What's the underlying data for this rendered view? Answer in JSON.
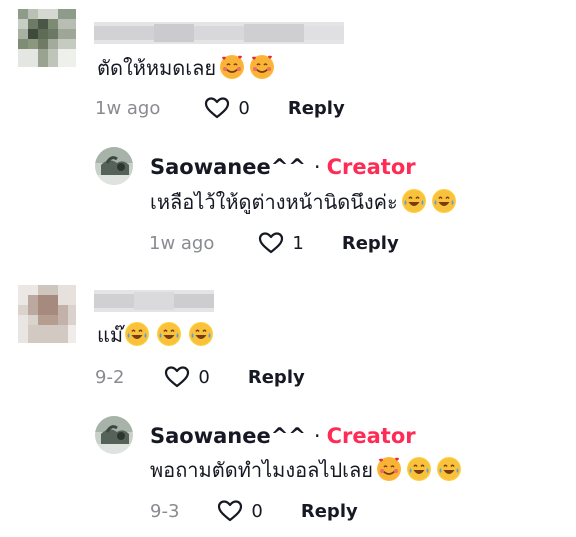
{
  "comments": [
    {
      "text": "ตัดให้หมดเลย",
      "emojis": [
        "smiling-face-with-hearts-icon",
        "smiling-face-with-hearts-icon"
      ],
      "time": "1w ago",
      "likes": "0",
      "reply_label": "Reply",
      "reply": {
        "username": "Saowanee^^",
        "separator": "·",
        "badge": "Creator",
        "text": "เหลือไว้ให้ดูต่างหน้านิดนึงค่ะ",
        "emojis": [
          "tears-of-joy-icon",
          "tears-of-joy-icon"
        ],
        "time": "1w ago",
        "likes": "1",
        "reply_label": "Reply"
      }
    },
    {
      "text": "แม๊",
      "emojis": [
        "tears-of-joy-icon",
        "tears-of-joy-icon",
        "tears-of-joy-icon"
      ],
      "time": "9-2",
      "likes": "0",
      "reply_label": "Reply",
      "reply": {
        "username": "Saowanee^^",
        "separator": "·",
        "badge": "Creator",
        "text": "พอถามตัดทำไมงอลไปเลย",
        "emojis": [
          "smiling-face-with-hearts-icon",
          "tears-of-joy-icon",
          "tears-of-joy-icon"
        ],
        "time": "9-3",
        "likes": "0",
        "reply_label": "Reply"
      }
    }
  ],
  "colors": {
    "creator": "#fe2c55",
    "time": "#8a8b91",
    "text": "#161823"
  }
}
